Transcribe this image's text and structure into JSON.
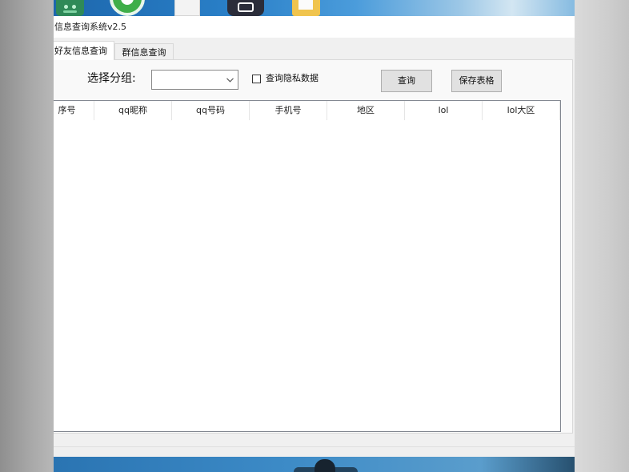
{
  "window": {
    "title": "信息查询系统v2.5"
  },
  "tabs": [
    {
      "label": "好友信息查询",
      "active": true
    },
    {
      "label": "群信息查询",
      "active": false
    }
  ],
  "filter": {
    "group_label": "选择分组:",
    "group_value": "",
    "privacy_label": "查询隐私数据",
    "privacy_checked": false
  },
  "buttons": {
    "query": "查询",
    "save_table": "保存表格"
  },
  "table": {
    "columns": [
      "序号",
      "qq昵称",
      "qq号码",
      "手机号",
      "地区",
      "lol",
      "lol大区"
    ],
    "rows": []
  },
  "desktop": {
    "icons": [
      "android-app-icon",
      "green-circle-app-icon",
      "document-icon",
      "bilibili-icon",
      "folder-icon"
    ]
  },
  "colors": {
    "window_bg": "#f0f0f0",
    "list_bg": "#ffffff",
    "button_bg": "#e1e1e1",
    "list_border": "#828790",
    "wallpaper": "#2a80c8"
  }
}
